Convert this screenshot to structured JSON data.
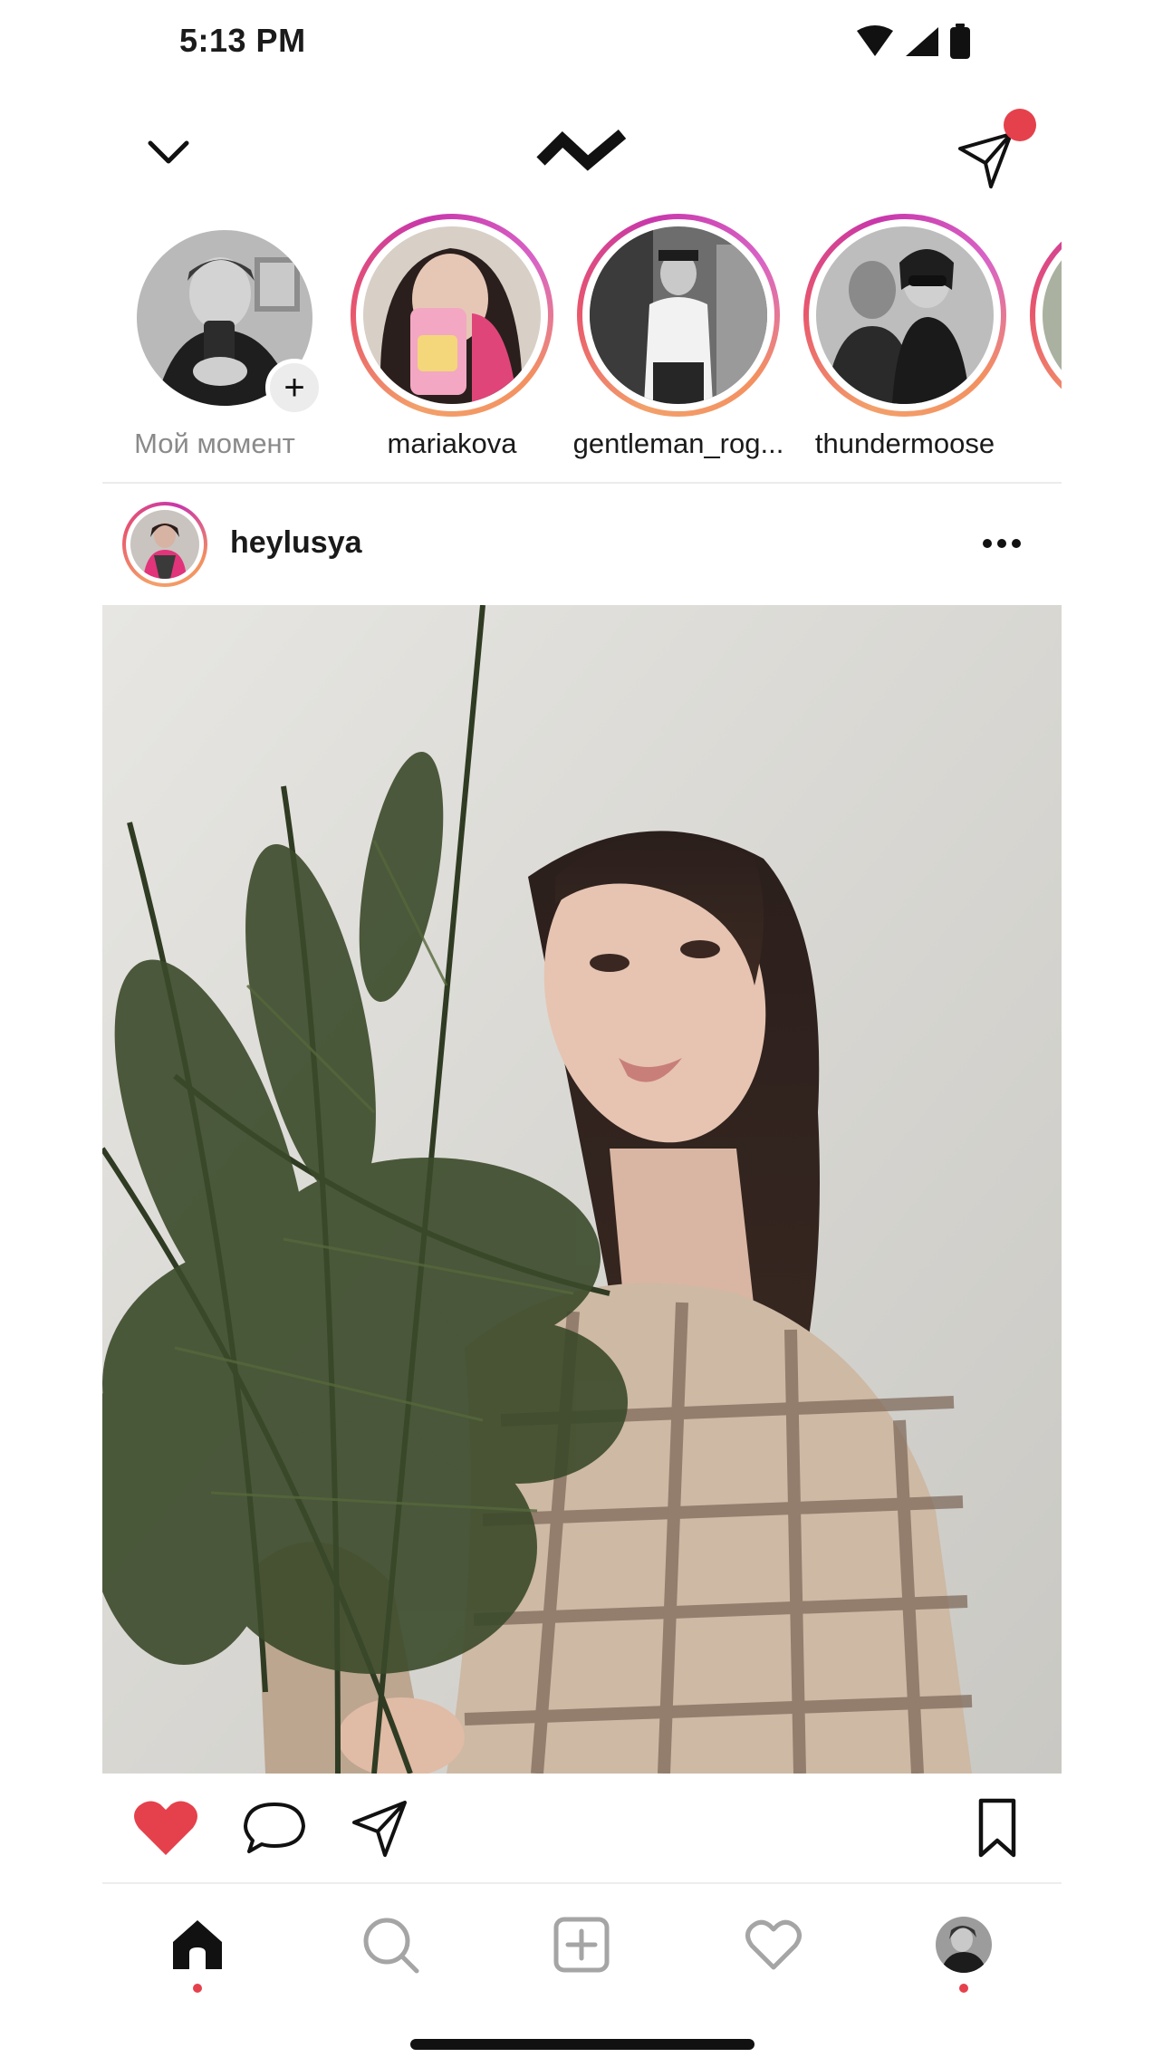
{
  "status_bar": {
    "time": "5:13 PM"
  },
  "top_bar": {
    "account_switcher_icon": "chevron-down-icon",
    "logo_icon": "zigzag-logo-icon",
    "direct_icon": "paper-plane-icon",
    "has_notification": true
  },
  "stories": [
    {
      "label": "Мой момент",
      "own": true
    },
    {
      "label": "mariakova",
      "own": false
    },
    {
      "label": "gentleman_rog...",
      "own": false
    },
    {
      "label": "thundermoose",
      "own": false
    }
  ],
  "post": {
    "username": "heylusya",
    "liked": true
  },
  "bottom_nav": {
    "items": [
      "home-icon",
      "search-icon",
      "add-post-icon",
      "heart-icon",
      "profile-avatar"
    ],
    "active": "home-icon"
  },
  "colors": {
    "accent_red": "#e5414c",
    "story_ring_start": "#f3a06a",
    "story_ring_mid": "#c837ab"
  }
}
